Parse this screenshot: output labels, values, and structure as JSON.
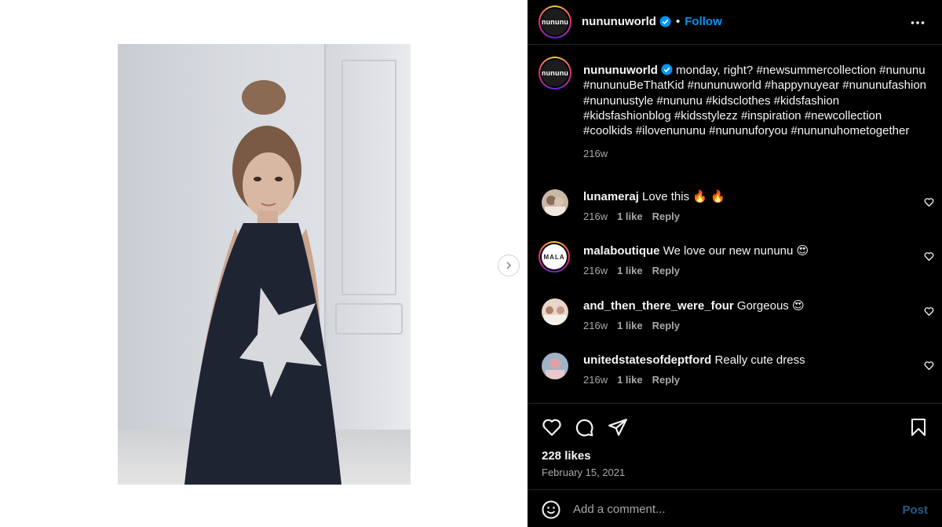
{
  "post": {
    "username": "nununuworld",
    "follow_label": "Follow",
    "separator": "•",
    "avatar_text": "nununu",
    "caption_head": "monday, right?",
    "caption_tags": "#newsummercollection #nununu #nununuBeThatKid #nununuworld #happynuyear #nununufashion #nununustyle #nununu #kidsclothes #kidsfashion #kidsfashionblog #kidsstylezz #inspiration #newcollection #coolkids #ilovenununu #nununuforyou #nununuhometogether",
    "caption_time": "216w",
    "likes": "228 likes",
    "date": "February 15, 2021"
  },
  "comments": [
    {
      "user": "lunameraj",
      "text": "Love this 🔥 🔥",
      "time": "216w",
      "likes": "1 like",
      "reply": "Reply"
    },
    {
      "user": "malaboutique",
      "text": "We love our new nununu 😍",
      "time": "216w",
      "likes": "1 like",
      "reply": "Reply",
      "avatar_text": "MALA"
    },
    {
      "user": "and_then_there_were_four",
      "text": "Gorgeous 😍",
      "time": "216w",
      "likes": "1 like",
      "reply": "Reply"
    },
    {
      "user": "unitedstatesofdeptford",
      "text": "Really cute dress",
      "time": "216w",
      "likes": "1 like",
      "reply": "Reply"
    }
  ],
  "comment_bar": {
    "placeholder": "Add a comment...",
    "post_label": "Post"
  },
  "icons": {
    "verified": "verified-badge-icon",
    "more": "more-options-icon",
    "like": "heart-icon",
    "comment": "comment-icon",
    "share": "share-icon",
    "save": "bookmark-icon",
    "emoji": "emoji-icon",
    "next": "chevron-right-icon"
  },
  "colors": {
    "accent": "#0095f6",
    "panel_bg": "#000000",
    "muted": "#a8a8a8"
  }
}
